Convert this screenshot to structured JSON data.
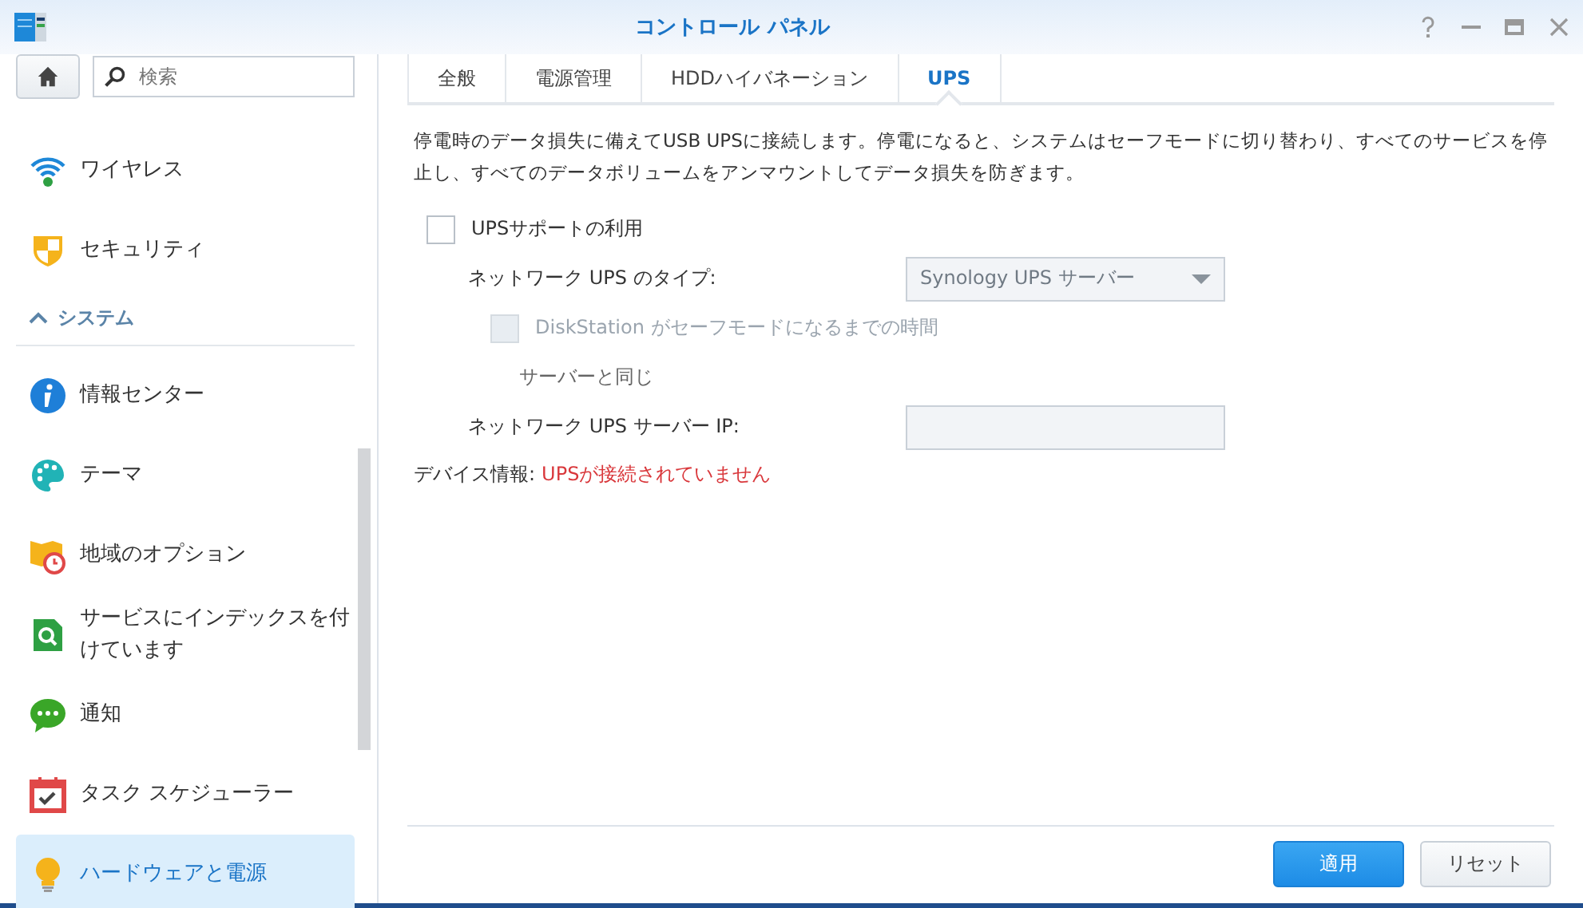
{
  "window": {
    "title": "コントロール パネル"
  },
  "sidebar": {
    "search": {
      "placeholder": "検索"
    },
    "items": [
      {
        "kind": "item",
        "label": "ワイヤレス",
        "selected": false
      },
      {
        "kind": "item",
        "label": "セキュリティ",
        "selected": false
      },
      {
        "kind": "section",
        "label": "システム",
        "expanded": true
      },
      {
        "kind": "item",
        "label": "情報センター",
        "selected": false
      },
      {
        "kind": "item",
        "label": "テーマ",
        "selected": false
      },
      {
        "kind": "item",
        "label": "地域のオプション",
        "selected": false
      },
      {
        "kind": "item",
        "label": "サービスにインデックスを付けています",
        "selected": false
      },
      {
        "kind": "item",
        "label": "通知",
        "selected": false
      },
      {
        "kind": "item",
        "label": "タスク スケジューラー",
        "selected": false
      },
      {
        "kind": "item",
        "label": "ハードウェアと電源",
        "selected": true
      }
    ]
  },
  "tabs": [
    {
      "label": "全般",
      "selected": false
    },
    {
      "label": "電源管理",
      "selected": false
    },
    {
      "label": "HDDハイバネーション",
      "selected": false
    },
    {
      "label": "UPS",
      "selected": true
    }
  ],
  "description": "停電時のデータ損失に備えてUSB UPSに接続します。停電になると、システムはセーフモードに切り替わり、すべてのサービスを停止し、すべてのデータボリュームをアンマウントしてデータ損失を防ぎます。",
  "form": [
    {
      "kind": "checkbox",
      "label": "UPSサポートの利用",
      "checked": false,
      "disabled": false
    },
    {
      "kind": "select",
      "label": "ネットワーク UPS のタイプ:",
      "value": "Synology UPS サーバー",
      "disabled": true
    },
    {
      "kind": "checkbox",
      "label": "DiskStation がセーフモードになるまでの時間",
      "checked": false,
      "disabled": true
    },
    {
      "kind": "note",
      "label": "サーバーと同じ"
    },
    {
      "kind": "input",
      "label": "ネットワーク UPS サーバー IP:",
      "disabled": true
    }
  ],
  "device_info": {
    "label": "デバイス情報:",
    "value": "UPSが接続されていません"
  },
  "buttons": [
    {
      "label": "適用",
      "primary": true
    },
    {
      "label": "リセット",
      "primary": false
    }
  ]
}
